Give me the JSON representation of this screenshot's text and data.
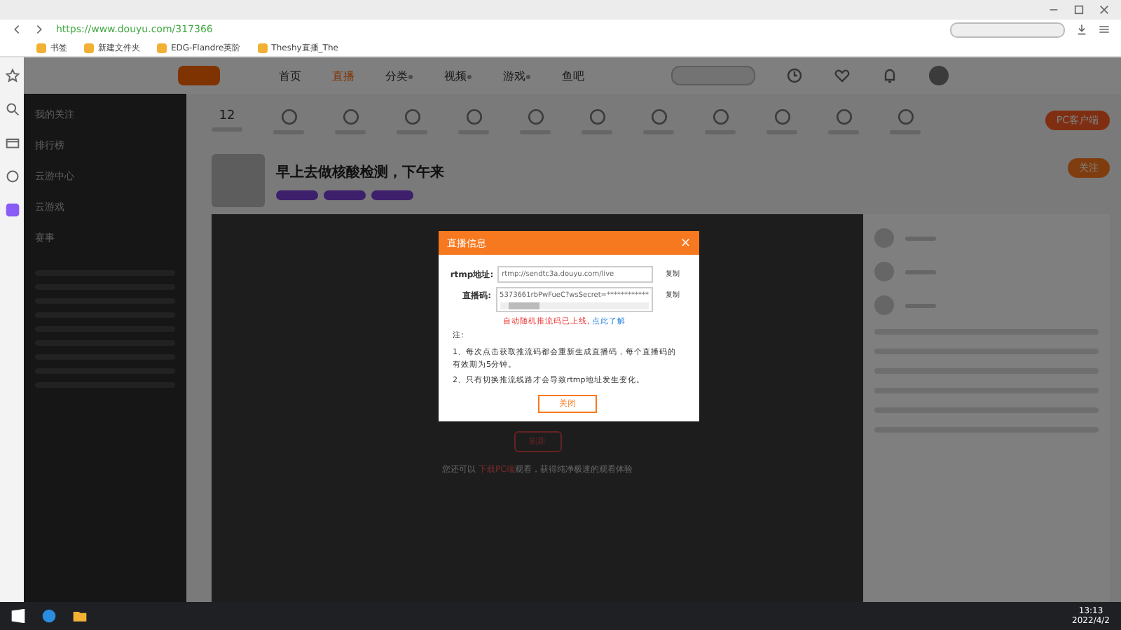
{
  "browser": {
    "url": "https://www.douyu.com/317366",
    "bookmarks": [
      "书签",
      "新建文件夹",
      "EDG-Flandre英阶",
      "Theshy直播_The"
    ]
  },
  "site": {
    "nav": [
      {
        "label": "首页",
        "selected": false,
        "has_menu": false
      },
      {
        "label": "直播",
        "selected": true,
        "has_menu": false
      },
      {
        "label": "分类",
        "selected": false,
        "has_menu": true
      },
      {
        "label": "视频",
        "selected": false,
        "has_menu": true
      },
      {
        "label": "游戏",
        "selected": false,
        "has_menu": true
      },
      {
        "label": "鱼吧",
        "selected": false,
        "has_menu": false
      }
    ]
  },
  "sidebar": {
    "items": [
      "我的关注",
      "排行榜",
      "云游中心",
      "云游戏",
      "赛事"
    ]
  },
  "toolbar": {
    "score": "12",
    "pc_button": "PC客户端"
  },
  "stream": {
    "title": "早上去做核酸检测，下午来",
    "follow": "关注"
  },
  "player": {
    "hint_prefix": "您还可以",
    "hint_link": "下载PC端",
    "hint_suffix": "观看，获得纯净极速的观看体验",
    "button": "刷新"
  },
  "dialog": {
    "title": "直播信息",
    "close": "×",
    "rtmp_label": "rtmp地址:",
    "rtmp_value": "rtmp://sendtc3a.douyu.com/live",
    "code_label": "直播码:",
    "code_value": "5373661rbPwFueC?wsSecret=************",
    "copy_rtmp": "复制",
    "copy_code": "复制",
    "warning": "自动随机推流码已上线,",
    "learn_more": "点此了解",
    "note_title": "注:",
    "notes": [
      "1、每次点击获取推流码都会重新生成直播码，每个直播码的有效期为5分钟。",
      "2、只有切换推流线路才会导致rtmp地址发生变化。"
    ],
    "button": "关闭"
  },
  "taskbar": {
    "time": "13:13",
    "date": "2022/4/2"
  }
}
